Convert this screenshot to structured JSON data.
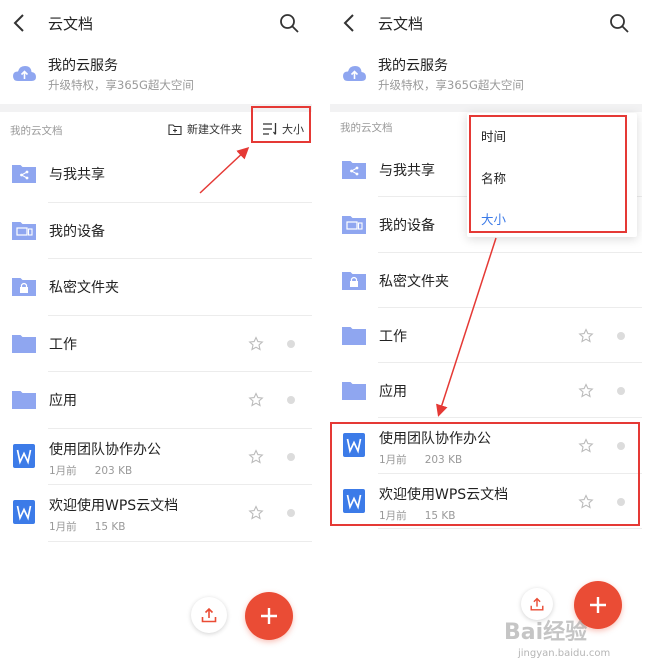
{
  "colors": {
    "accent_red": "#ea4c35",
    "folder_blue": "#8fa6f0",
    "doc_blue": "#3c7be8",
    "annotation_red": "#e53935"
  },
  "left": {
    "topbar": {
      "title": "云文档",
      "back_icon": "chevron-left-icon",
      "search_icon": "search-icon"
    },
    "cloud": {
      "title": "我的云服务",
      "subtitle": "升级特权，享365G超大空间",
      "icon": "cloud-upload-icon"
    },
    "section": {
      "label": "我的云文档",
      "new_folder": "新建文件夹",
      "sort_label": "大小"
    },
    "items": [
      {
        "name": "与我共享",
        "icon": "shared-folder-icon"
      },
      {
        "name": "我的设备",
        "icon": "device-folder-icon"
      },
      {
        "name": "私密文件夹",
        "icon": "private-folder-icon"
      },
      {
        "name": "工作",
        "icon": "folder-icon"
      },
      {
        "name": "应用",
        "icon": "folder-icon"
      },
      {
        "name": "使用团队协作办公",
        "time": "1月前",
        "size": "203 KB",
        "icon": "word-doc-icon"
      },
      {
        "name": "欢迎使用WPS云文档",
        "time": "1月前",
        "size": "15 KB",
        "icon": "word-doc-icon"
      }
    ]
  },
  "right": {
    "topbar": {
      "title": "云文档"
    },
    "cloud": {
      "title": "我的云服务",
      "subtitle": "升级特权，享365G超大空间"
    },
    "section": {
      "label": "我的云文档"
    },
    "sort_menu": {
      "options": [
        "时间",
        "名称",
        "大小"
      ],
      "selected": "大小"
    },
    "items": [
      {
        "name": "与我共享"
      },
      {
        "name": "我的设备"
      },
      {
        "name": "私密文件夹"
      },
      {
        "name": "工作"
      },
      {
        "name": "应用"
      },
      {
        "name": "使用团队协作办公",
        "time": "1月前",
        "size": "203 KB"
      },
      {
        "name": "欢迎使用WPS云文档",
        "time": "1月前",
        "size": "15 KB"
      }
    ]
  },
  "watermark": {
    "main": "Bai经验",
    "sub": "jingyan.baidu.com"
  }
}
